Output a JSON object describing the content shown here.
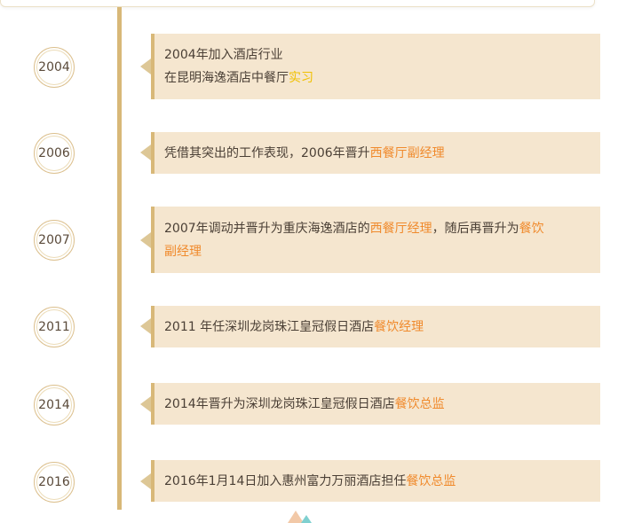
{
  "timeline": [
    {
      "year": "2004",
      "lines": [
        [
          {
            "text": "2004年加入酒店行业"
          }
        ],
        [
          {
            "text": "在昆明海逸酒店中餐厅"
          },
          {
            "text": "实习",
            "hl": "yellow"
          }
        ]
      ]
    },
    {
      "year": "2006",
      "lines": [
        [
          {
            "text": "凭借其突出的工作表现，2006年晋升"
          },
          {
            "text": "西餐厅副经理",
            "hl": "orange"
          }
        ]
      ]
    },
    {
      "year": "2007",
      "lines": [
        [
          {
            "text": "2007年调动并晋升为重庆海逸酒店的"
          },
          {
            "text": "西餐厅经理",
            "hl": "orange"
          },
          {
            "text": "，随后再晋升为"
          },
          {
            "text": "餐饮",
            "hl": "orange"
          }
        ],
        [
          {
            "text": "副经理",
            "hl": "orange"
          }
        ]
      ]
    },
    {
      "year": "2011",
      "lines": [
        [
          {
            "text": "2011 年任深圳龙岗珠江皇冠假日酒店"
          },
          {
            "text": "餐饮经理",
            "hl": "orange"
          }
        ]
      ]
    },
    {
      "year": "2014",
      "lines": [
        [
          {
            "text": "2014年晋升为深圳龙岗珠江皇冠假日酒店"
          },
          {
            "text": "餐饮总监",
            "hl": "orange"
          }
        ]
      ]
    },
    {
      "year": "2016",
      "lines": [
        [
          {
            "text": "2016年1月14日加入惠州富力万丽酒店担任"
          },
          {
            "text": "餐饮总监",
            "hl": "orange"
          }
        ]
      ]
    }
  ],
  "colors": {
    "axis": "#d8b878",
    "card_bg": "#f5e6cf",
    "highlight_yellow": "#f0c000",
    "highlight_orange": "#f08a2c"
  }
}
